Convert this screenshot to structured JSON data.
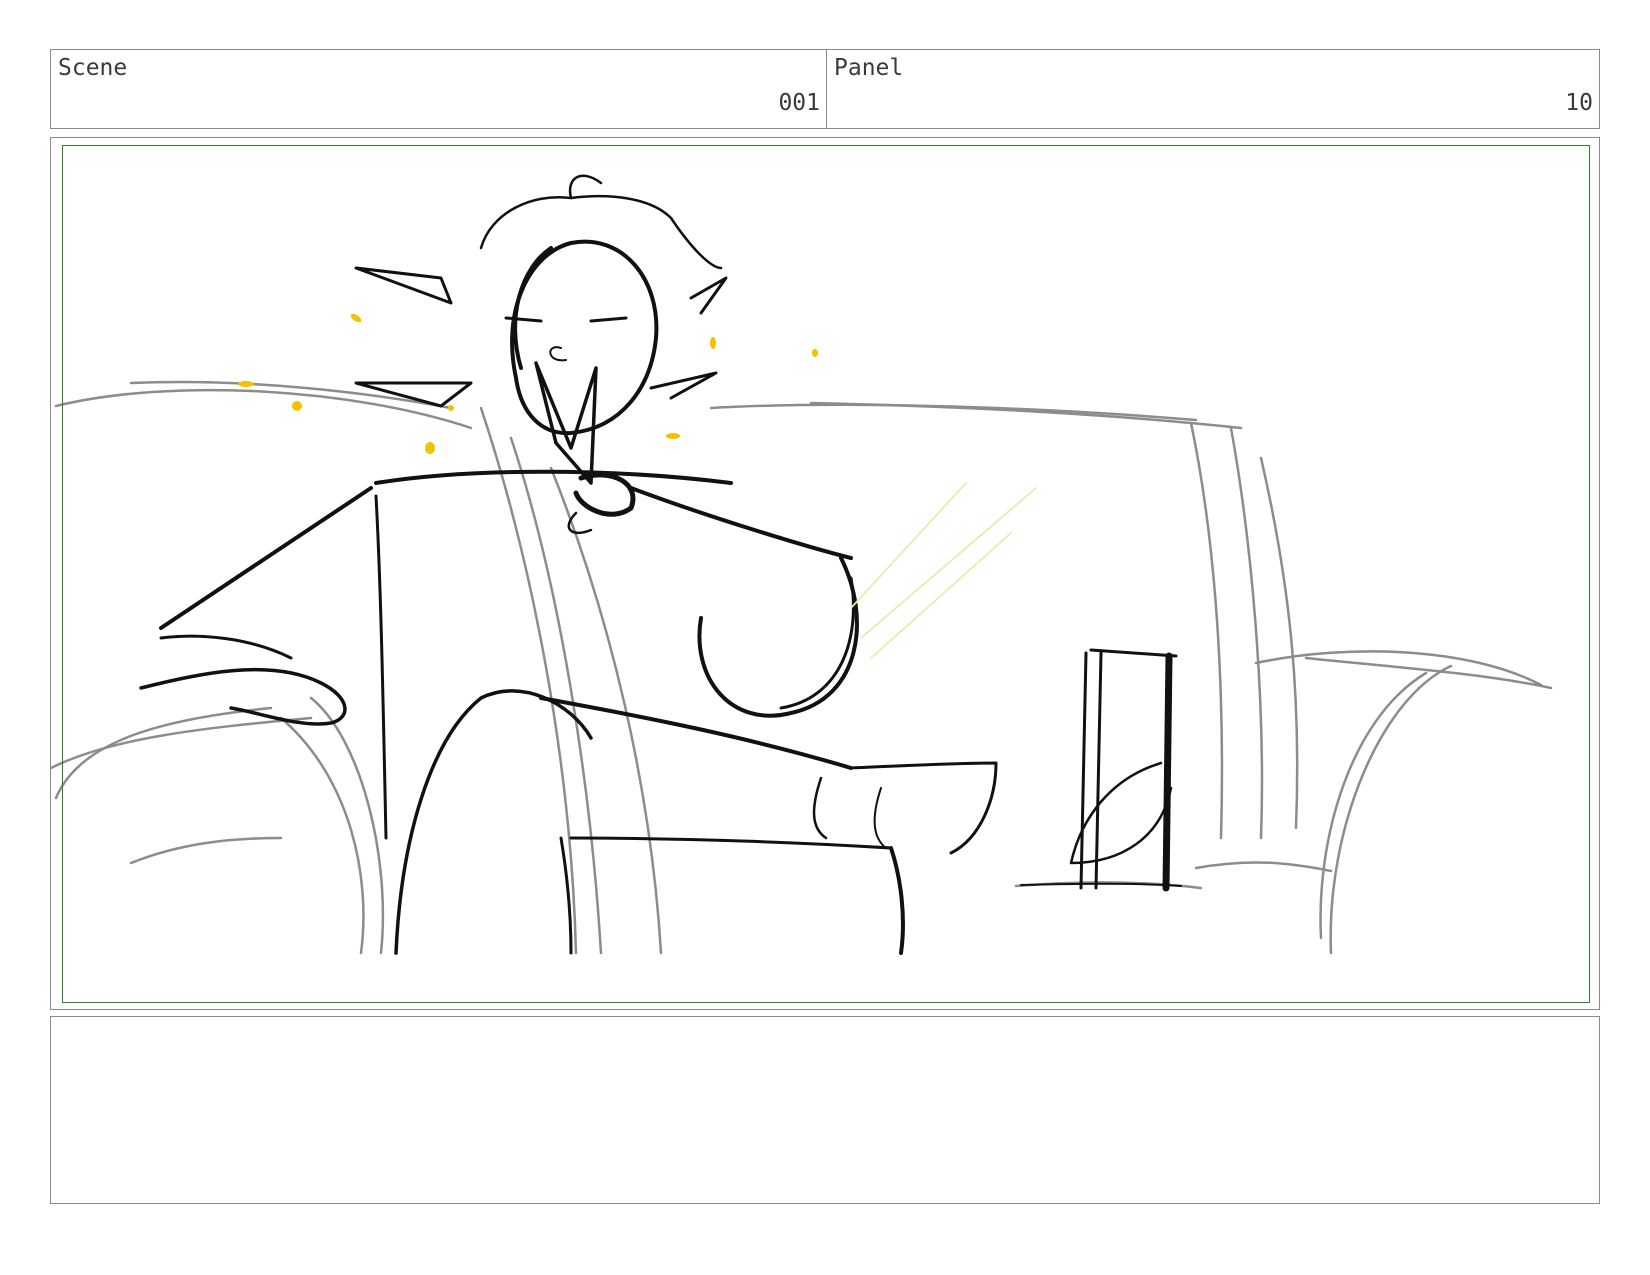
{
  "header": {
    "scene_label": "Scene",
    "scene_number": "001",
    "panel_label": "Panel",
    "panel_number": "10"
  },
  "notes": {
    "text": ""
  },
  "colors": {
    "border": "#8a8a8a",
    "safe_frame": "#2e7d32",
    "ink": "#111111",
    "background_sketch": "#8c8c8c",
    "sparkle": "#f2c200"
  }
}
